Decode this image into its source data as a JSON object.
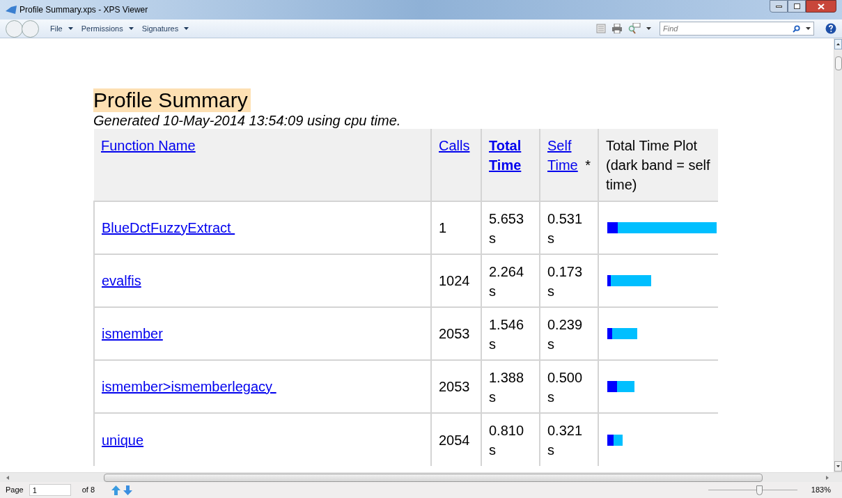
{
  "window": {
    "title": "Profile Summary.xps - XPS Viewer"
  },
  "menus": [
    "File",
    "Permissions",
    "Signatures"
  ],
  "find": {
    "placeholder": "Find"
  },
  "document": {
    "title": "Profile Summary",
    "subtitle": "Generated 10-May-2014 13:54:09 using cpu time.",
    "columns": [
      {
        "kind": "link",
        "label": "Function Name",
        "bold": false
      },
      {
        "kind": "link",
        "label": "Calls",
        "bold": false
      },
      {
        "kind": "link",
        "label": "Total Time",
        "bold": true
      },
      {
        "kind": "link",
        "label": "Self Time",
        "bold": false,
        "suffix": "*"
      },
      {
        "kind": "plain",
        "label": "Total Time Plot (dark band = self time)"
      }
    ],
    "rows": [
      {
        "function": "BlueDctFuzzyExtract ",
        "calls": "1",
        "total_time": "5.653 s",
        "self_time": "0.531 s"
      },
      {
        "function": "evalfis",
        "calls": "1024",
        "total_time": "2.264 s",
        "self_time": "0.173 s"
      },
      {
        "function": "ismember",
        "calls": "2053",
        "total_time": "1.546 s",
        "self_time": "0.239 s"
      },
      {
        "function": "ismember>ismemberlegacy ",
        "calls": "2053",
        "total_time": "1.388 s",
        "self_time": "0.500 s"
      },
      {
        "function": "unique",
        "calls": "2054",
        "total_time": "0.810 s",
        "self_time": "0.321 s"
      }
    ]
  },
  "status_bar": {
    "page_label": "Page",
    "page": "1",
    "of": "of 8",
    "zoom": {
      "level": 0.58,
      "reading": "183%"
    }
  }
}
